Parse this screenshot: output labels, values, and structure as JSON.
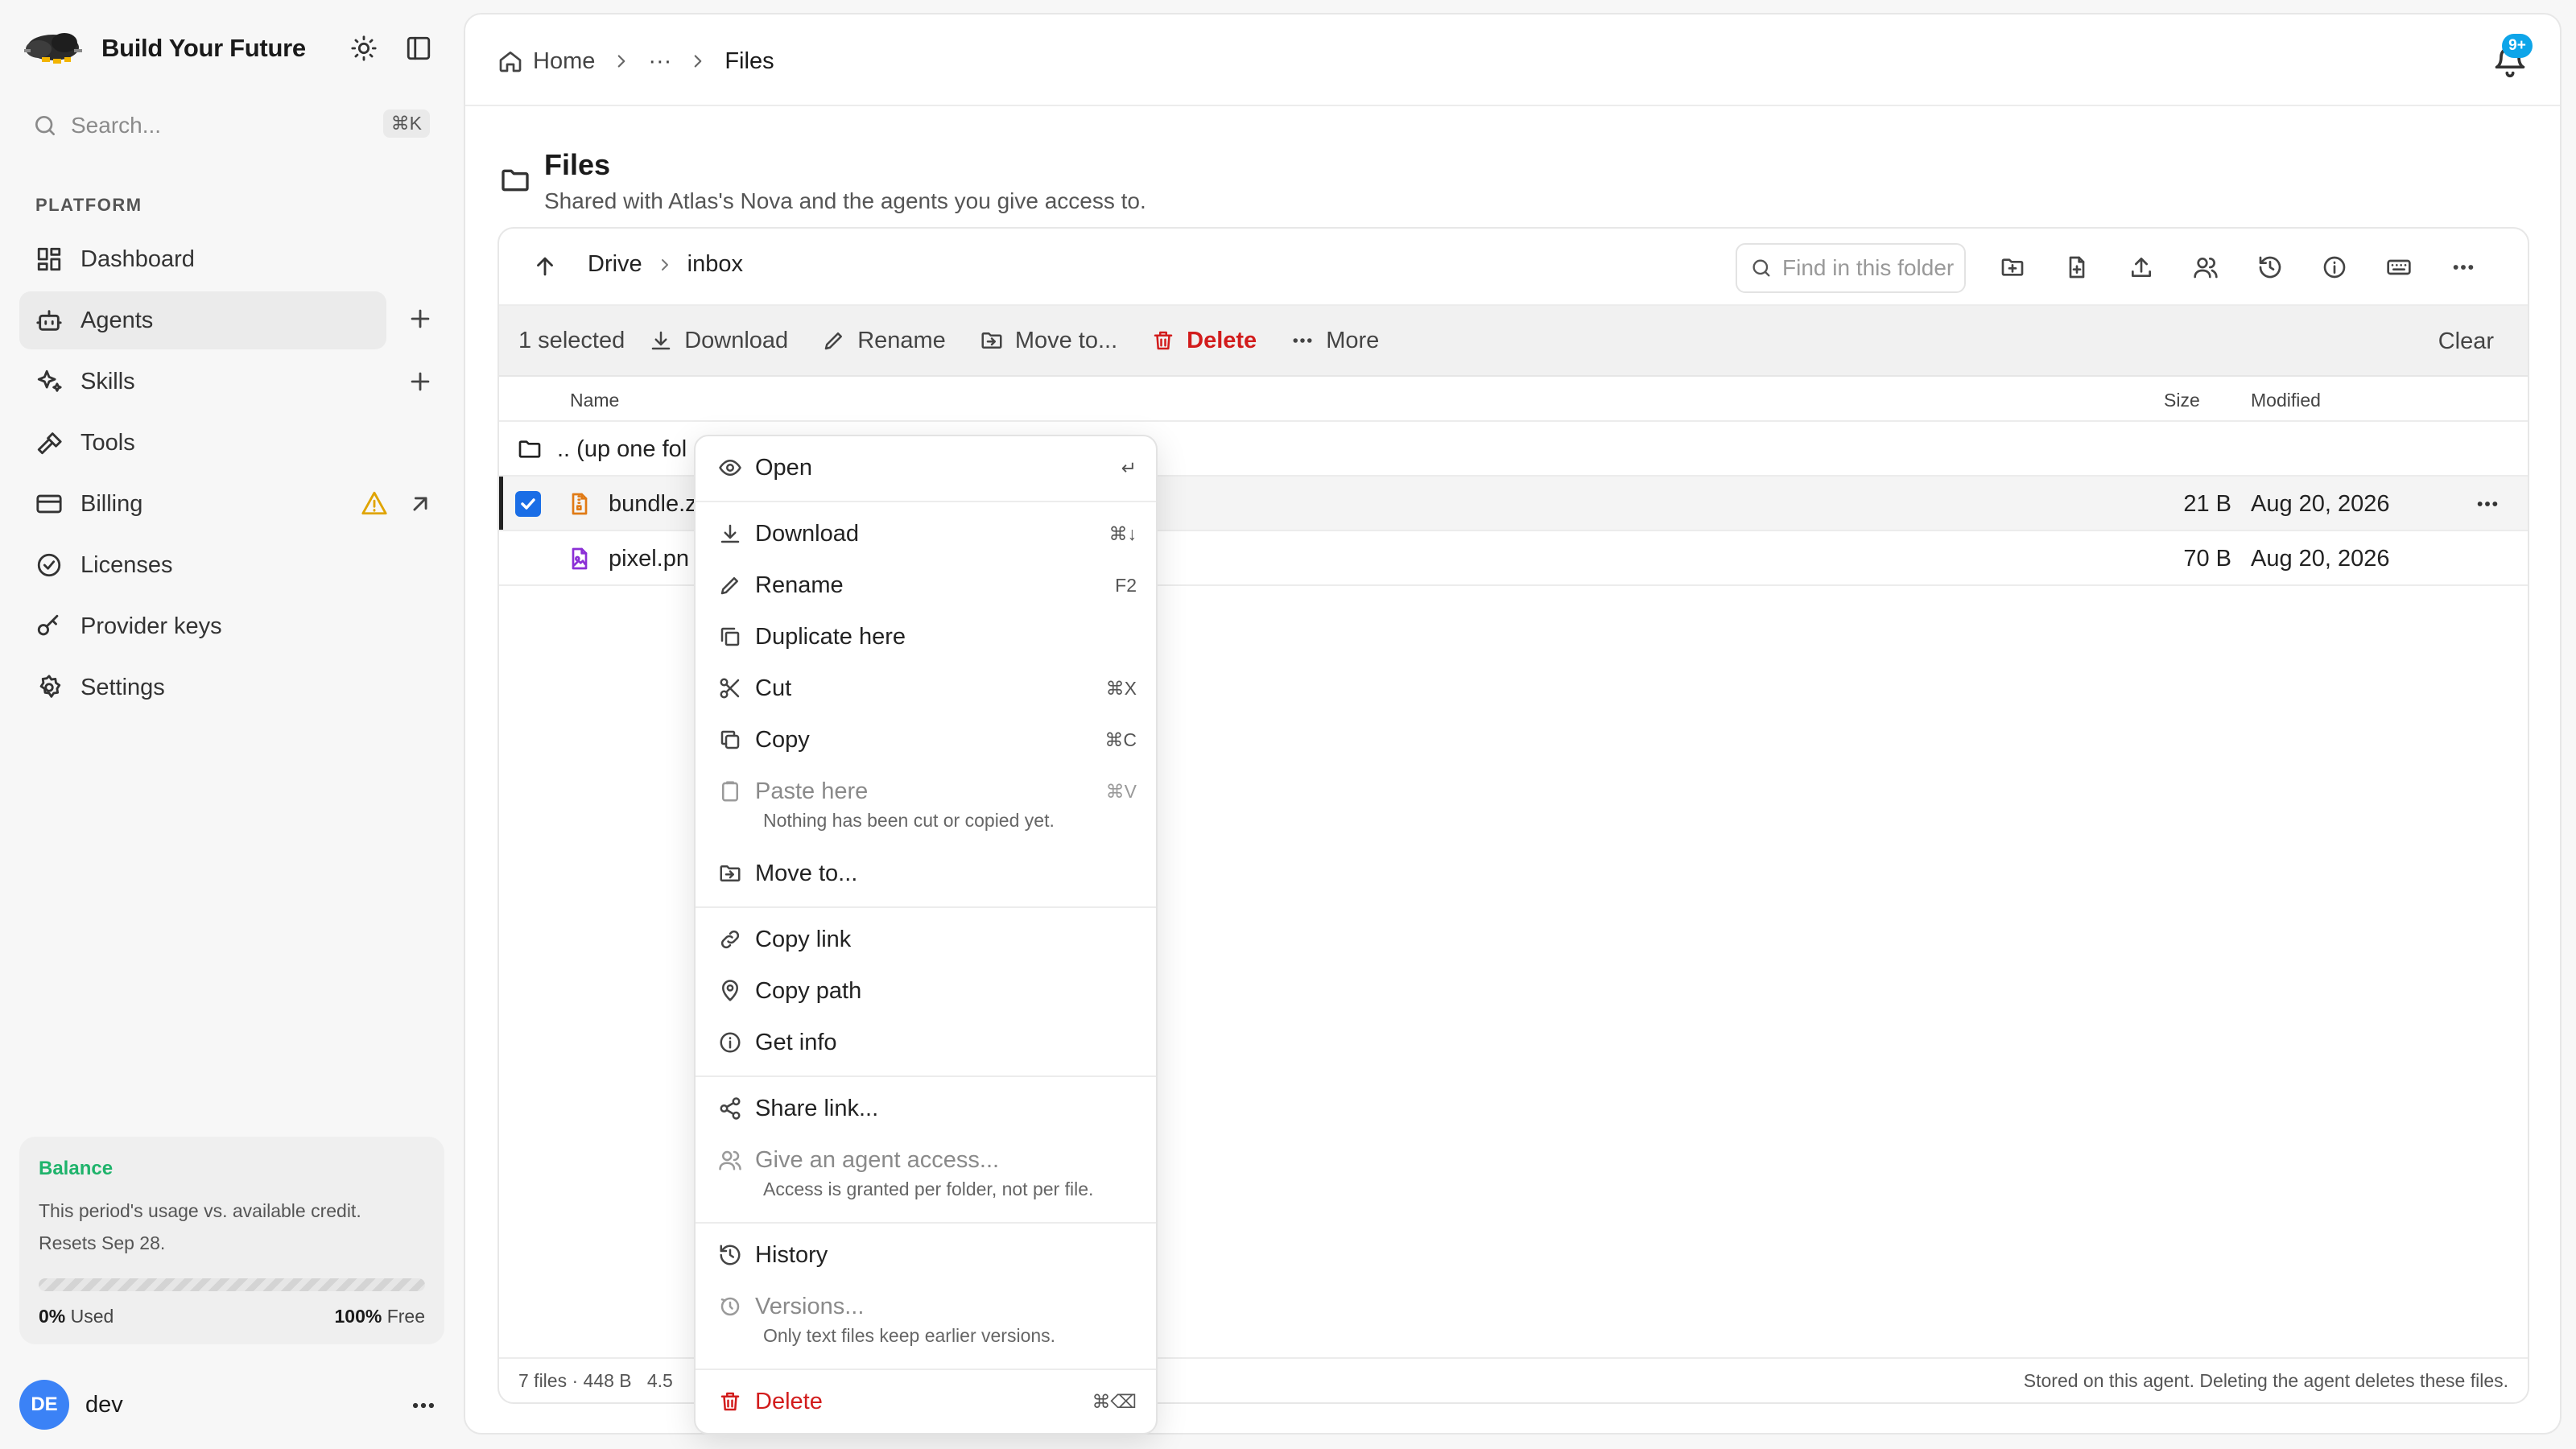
{
  "brand": {
    "title": "Build Your Future"
  },
  "search": {
    "placeholder": "Search...",
    "shortcut": "⌘K"
  },
  "sidebar": {
    "section_label": "PLATFORM",
    "items": [
      {
        "label": "Dashboard",
        "icon": "dashboard-icon"
      },
      {
        "label": "Agents",
        "icon": "bot-icon",
        "active": true,
        "action": "plus-icon"
      },
      {
        "label": "Skills",
        "icon": "sparkles-icon",
        "action": "plus-icon"
      },
      {
        "label": "Tools",
        "icon": "hammer-icon"
      },
      {
        "label": "Billing",
        "icon": "credit-card-icon",
        "warning": true,
        "action": "external-link-icon"
      },
      {
        "label": "Licenses",
        "icon": "badge-check-icon"
      },
      {
        "label": "Provider keys",
        "icon": "key-icon"
      },
      {
        "label": "Settings",
        "icon": "gear-icon"
      }
    ]
  },
  "balance": {
    "title": "Balance",
    "description": "This period's usage vs. available credit. Resets Sep 28.",
    "used_pct": "0%",
    "used_label": "Used",
    "free_pct": "100%",
    "free_label": "Free",
    "used_fraction": 0
  },
  "user": {
    "initials": "DE",
    "name": "dev"
  },
  "breadcrumb": {
    "home": "Home",
    "ellipsis": "···",
    "current": "Files"
  },
  "notifications": {
    "badge": "9+"
  },
  "page": {
    "title": "Files",
    "subtitle": "Shared with Atlas's Nova and the agents you give access to."
  },
  "browser": {
    "path": [
      "Drive",
      "inbox"
    ],
    "find_placeholder": "Find in this folder"
  },
  "selection": {
    "count": "1 selected",
    "download": "Download",
    "rename": "Rename",
    "move": "Move to...",
    "delete": "Delete",
    "more": "More",
    "clear": "Clear"
  },
  "table": {
    "columns": {
      "name": "Name",
      "size": "Size",
      "modified": "Modified"
    },
    "up_folder": ".. (up one fol",
    "rows": [
      {
        "name": "bundle.z",
        "size": "21 B",
        "modified": "Aug 20, 2026",
        "selected": true,
        "icon": "file-archive-icon"
      },
      {
        "name": "pixel.pn",
        "size": "70 B",
        "modified": "Aug 20, 2026",
        "selected": false,
        "icon": "file-image-icon"
      }
    ]
  },
  "footer": {
    "summary": "7 files · 448 B",
    "summary_extra": "4.5",
    "note": "Stored on this agent. Deleting the agent deletes these files."
  },
  "context_menu": {
    "open": "Open",
    "open_shortcut": "↵",
    "download": "Download",
    "download_shortcut": "⌘↓",
    "rename": "Rename",
    "rename_shortcut": "F2",
    "duplicate": "Duplicate here",
    "cut": "Cut",
    "cut_shortcut": "⌘X",
    "copy": "Copy",
    "copy_shortcut": "⌘C",
    "paste": "Paste here",
    "paste_shortcut": "⌘V",
    "paste_hint": "Nothing has been cut or copied yet.",
    "move": "Move to...",
    "copy_link": "Copy link",
    "copy_path": "Copy path",
    "get_info": "Get info",
    "share_link": "Share link...",
    "give_access": "Give an agent access...",
    "give_access_hint": "Access is granted per folder, not per file.",
    "history": "History",
    "versions": "Versions...",
    "versions_hint": "Only text files keep earlier versions.",
    "delete": "Delete",
    "delete_shortcut": "⌘⌫"
  },
  "colors": {
    "accent": "#1a6ee6",
    "danger": "#d21c1c",
    "balance_green": "#1fb36b",
    "warning": "#e0a400",
    "badge": "#0ea5e9"
  }
}
